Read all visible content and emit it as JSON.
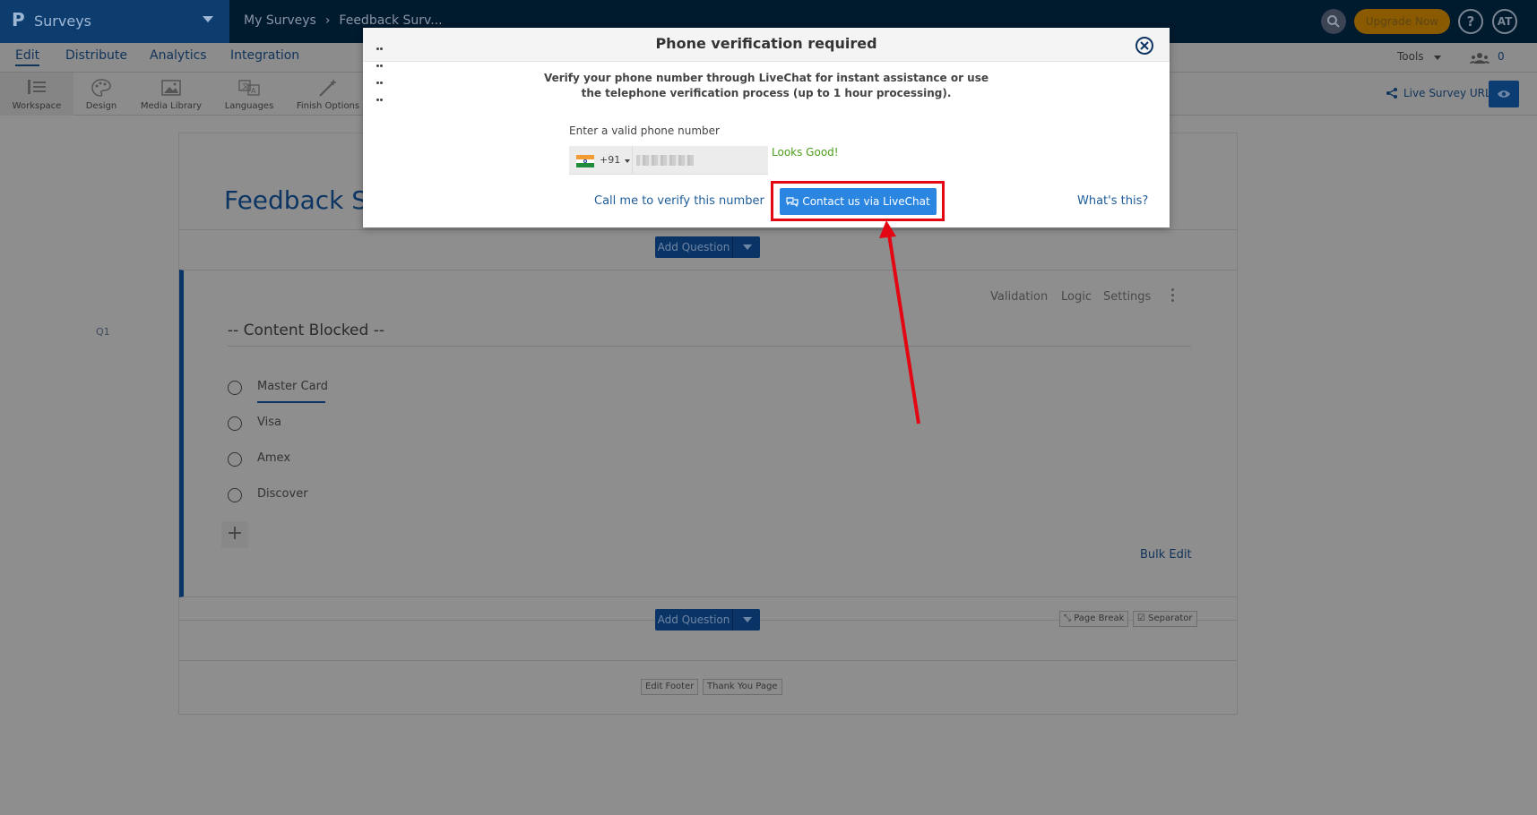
{
  "app": {
    "name": "Surveys",
    "breadcrumb": [
      "My Surveys",
      "Feedback Surv..."
    ]
  },
  "topbar": {
    "upgrade_label": "Upgrade Now",
    "help_label": "?",
    "avatar_initials": "AT"
  },
  "tabs": [
    {
      "label": "Edit",
      "active": true
    },
    {
      "label": "Distribute",
      "active": false
    },
    {
      "label": "Analytics",
      "active": false
    },
    {
      "label": "Integration",
      "active": false
    }
  ],
  "tabs_right": {
    "tools_label": "Tools",
    "collaborator_count": "0"
  },
  "toolbar": {
    "items": [
      {
        "label": "Workspace",
        "icon": "workspace-icon",
        "selected": true
      },
      {
        "label": "Design",
        "icon": "palette-icon",
        "selected": false
      },
      {
        "label": "Media Library",
        "icon": "image-icon",
        "selected": false
      },
      {
        "label": "Languages",
        "icon": "translate-icon",
        "selected": false
      },
      {
        "label": "Finish Options",
        "icon": "magic-wand-icon",
        "selected": false
      }
    ],
    "live_survey_url_label": "Live Survey URL"
  },
  "survey": {
    "title": "Feedback S",
    "add_question_label": "Add Question",
    "question": {
      "number": "Q1",
      "text": "-- Content Blocked --",
      "actions": [
        "Validation",
        "Logic",
        "Settings"
      ],
      "options": [
        "Master Card",
        "Visa",
        "Amex",
        "Discover"
      ],
      "bulk_edit_label": "Bulk Edit"
    },
    "page_break_label": "Page Break",
    "separator_label": "Separator",
    "edit_footer_label": "Edit Footer",
    "thank_you_page_label": "Thank You Page"
  },
  "modal": {
    "title": "Phone verification required",
    "description_line1": "Verify your phone number through LiveChat for instant assistance or use",
    "description_line2": "the telephone verification process (up to 1 hour processing).",
    "phone_label": "Enter a valid phone number",
    "country_code": "+91",
    "validation_message": "Looks Good!",
    "call_link_label": "Call me to verify this number",
    "livechat_button_label": "Contact us via LiveChat",
    "whats_this_label": "What's this?"
  },
  "colors": {
    "brand_dark": "#0b3466",
    "livechat_blue": "#2b86e2",
    "highlight_red": "#e30613",
    "success_green": "#4c9d1a",
    "upgrade_orange": "#8a5a00"
  }
}
